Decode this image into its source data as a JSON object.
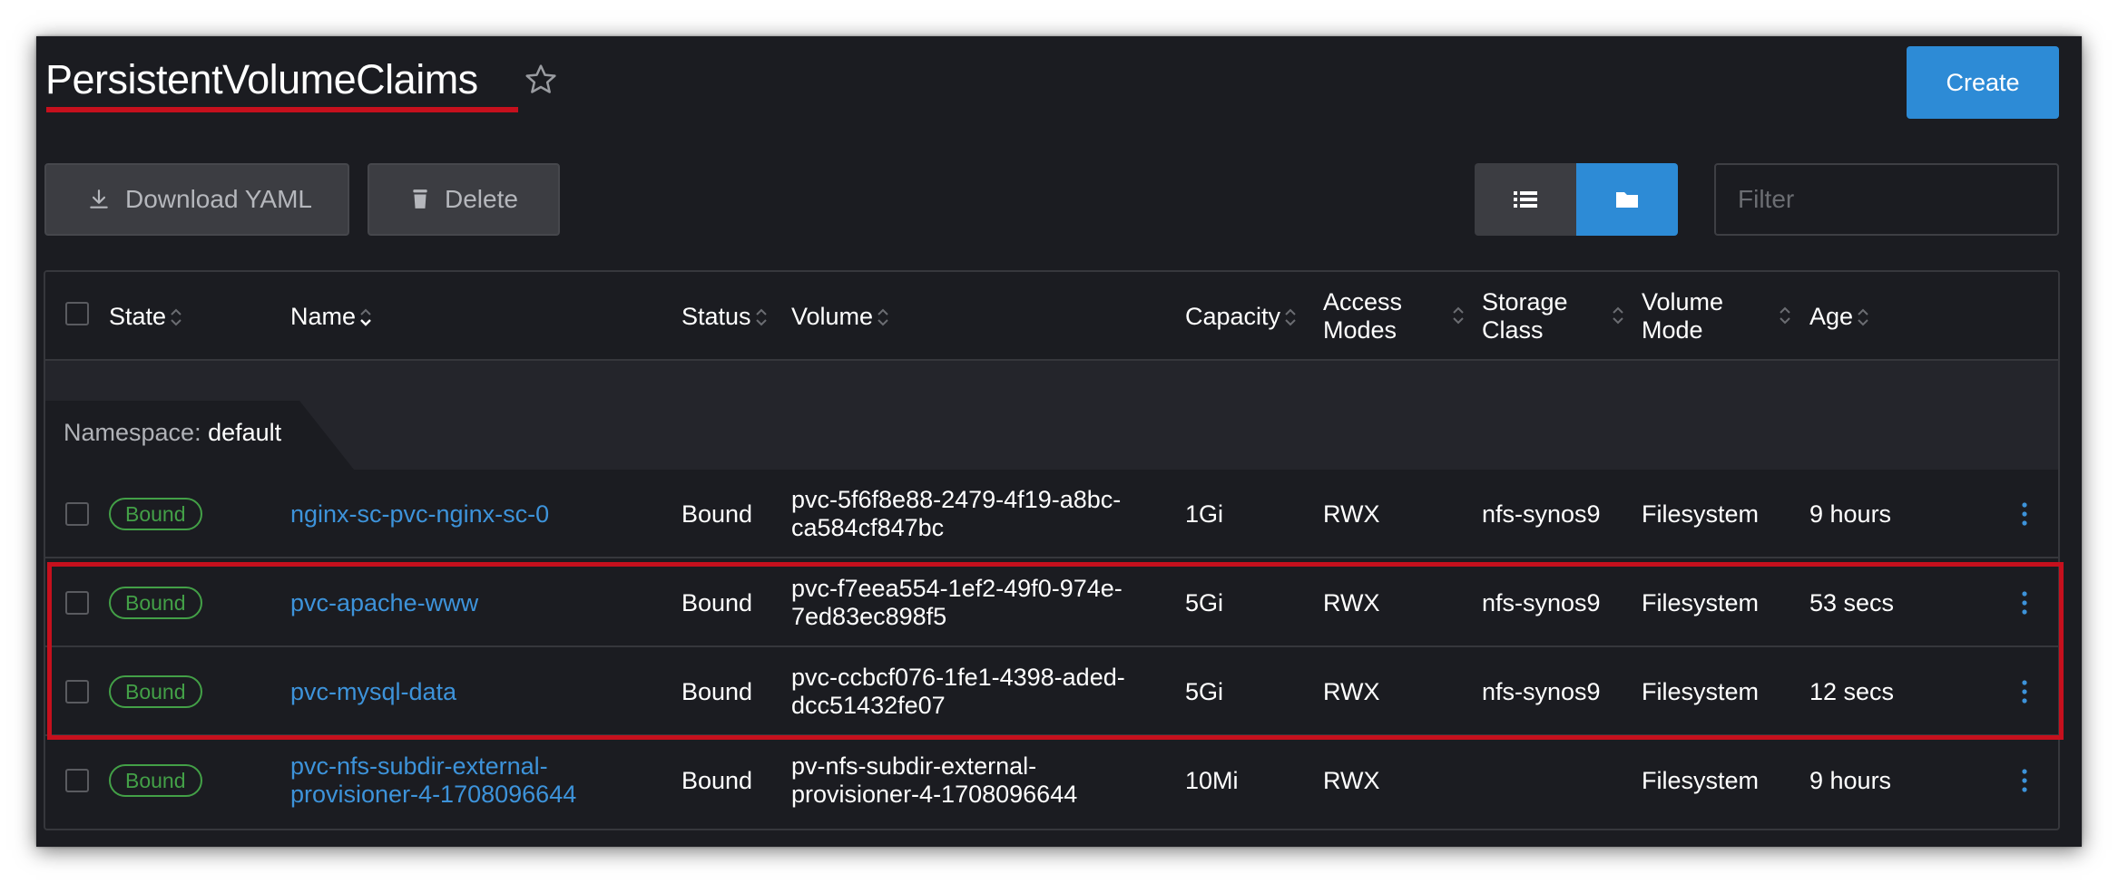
{
  "header": {
    "title": "PersistentVolumeClaims",
    "create_label": "Create"
  },
  "toolbar": {
    "download_label": "Download YAML",
    "delete_label": "Delete",
    "filter_placeholder": "Filter"
  },
  "table": {
    "columns": {
      "state": "State",
      "name": "Name",
      "status": "Status",
      "volume": "Volume",
      "capacity": "Capacity",
      "access_modes_1": "Access",
      "access_modes_2": "Modes",
      "storage_class_1": "Storage",
      "storage_class_2": "Class",
      "volume_mode_1": "Volume",
      "volume_mode_2": "Mode",
      "age": "Age"
    },
    "group": {
      "label": "Namespace:",
      "value": "default"
    },
    "rows": [
      {
        "state": "Bound",
        "name": "nginx-sc-pvc-nginx-sc-0",
        "status": "Bound",
        "volume_1": "pvc-5f6f8e88-2479-4f19-a8bc-",
        "volume_2": "ca584cf847bc",
        "capacity": "1Gi",
        "access_modes": "RWX",
        "storage_class": "nfs-synos9",
        "volume_mode": "Filesystem",
        "age": "9 hours"
      },
      {
        "state": "Bound",
        "name": "pvc-apache-www",
        "status": "Bound",
        "volume_1": "pvc-f7eea554-1ef2-49f0-974e-",
        "volume_2": "7ed83ec898f5",
        "capacity": "5Gi",
        "access_modes": "RWX",
        "storage_class": "nfs-synos9",
        "volume_mode": "Filesystem",
        "age": "53 secs"
      },
      {
        "state": "Bound",
        "name": "pvc-mysql-data",
        "status": "Bound",
        "volume_1": "pvc-ccbcf076-1fe1-4398-aded-",
        "volume_2": "dcc51432fe07",
        "capacity": "5Gi",
        "access_modes": "RWX",
        "storage_class": "nfs-synos9",
        "volume_mode": "Filesystem",
        "age": "12 secs"
      },
      {
        "state": "Bound",
        "name_1": "pvc-nfs-subdir-external-",
        "name_2": "provisioner-4-1708096644",
        "status": "Bound",
        "volume_1": "pv-nfs-subdir-external-",
        "volume_2": "provisioner-4-1708096644",
        "capacity": "10Mi",
        "access_modes": "RWX",
        "storage_class": "",
        "volume_mode": "Filesystem",
        "age": "9 hours"
      }
    ]
  },
  "colors": {
    "background": "#1b1c21",
    "accent": "#2d8bd6",
    "link": "#3d93da",
    "bound_badge": "#43a047",
    "highlight": "#c6101d"
  }
}
